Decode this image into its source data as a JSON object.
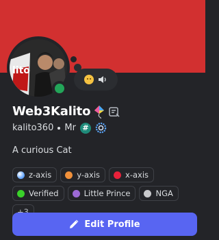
{
  "profile": {
    "display_name": "Web3Kalito",
    "username": "kalito360",
    "pronoun": "Mr",
    "bio": "A curious Cat",
    "status": "online",
    "activity_icons": [
      "smiley-emoji-icon",
      "speaker-icon"
    ],
    "name_icons": [
      "kite-emoji-icon",
      "note-icon"
    ],
    "badge_icons": [
      "hash-badge-icon",
      "gear-badge-icon"
    ],
    "avatar_text": "lito"
  },
  "tags": [
    {
      "label": "z-axis",
      "color": "#6aa9ff"
    },
    {
      "label": "y-axis",
      "color": "#f0903a"
    },
    {
      "label": "x-axis",
      "color": "#e8213a"
    },
    {
      "label": "Verified",
      "color": "#3ad12a"
    },
    {
      "label": "Little Prince",
      "color": "#9d6ad6"
    },
    {
      "label": "NGA",
      "color": "#c8c9cc"
    }
  ],
  "more_tags": "+3",
  "actions": {
    "edit_profile": "Edit Profile"
  },
  "colors": {
    "banner": "#d23030",
    "background": "#232428",
    "accent": "#5865f2",
    "online": "#23a559"
  }
}
